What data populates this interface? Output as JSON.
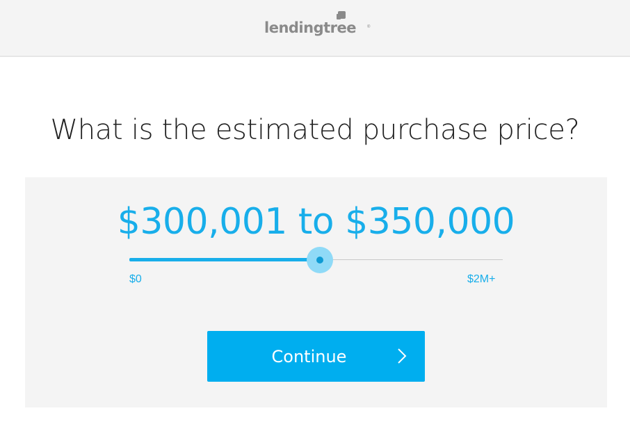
{
  "header": {
    "logo_text": "lendingtree",
    "logo_tm": "®"
  },
  "question": "What is the estimated purchase price?",
  "slider": {
    "value_label": "$300,001 to $350,000",
    "min_label": "$0",
    "max_label": "$2M+",
    "position_fraction": 0.51
  },
  "continue": {
    "label": "Continue",
    "icon": "chevron-right-icon"
  },
  "colors": {
    "accent": "#18aeea",
    "button": "#00aeef",
    "header_bg": "#f4f4f4",
    "panel_bg": "#f4f4f4",
    "logo": "#8a8a8a"
  }
}
